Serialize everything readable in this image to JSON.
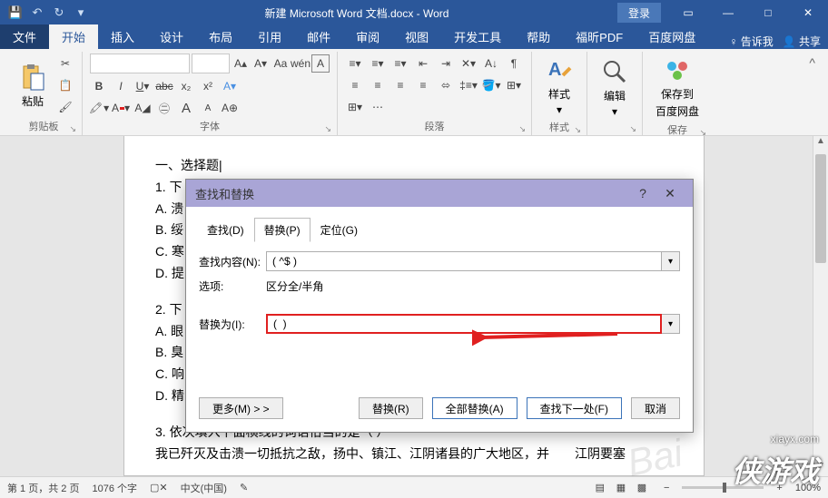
{
  "titlebar": {
    "doc_title": "新建 Microsoft Word 文档.docx - Word",
    "login": "登录"
  },
  "tabs": {
    "file": "文件",
    "home": "开始",
    "insert": "插入",
    "design": "设计",
    "layout": "布局",
    "ref": "引用",
    "mail": "邮件",
    "review": "审阅",
    "view": "视图",
    "dev": "开发工具",
    "help": "帮助",
    "foxit": "福昕PDF",
    "baidu": "百度网盘",
    "tell": "告诉我",
    "share": "共享"
  },
  "clipboard": {
    "paste": "粘贴",
    "group": "剪贴板"
  },
  "font": {
    "group": "字体",
    "wen": "wén",
    "a_box": "A"
  },
  "para": {
    "group": "段落"
  },
  "styles": {
    "label": "样式",
    "group": "样式"
  },
  "editing": {
    "label": "编辑"
  },
  "baidu_save": {
    "line1": "保存到",
    "line2": "百度网盘",
    "group": "保存"
  },
  "document": {
    "l1": "一、选择题",
    "l2": "1. 下",
    "l3": "A. 溃",
    "l4": "B. 绥",
    "l5": "C. 寒",
    "l6": "D. 提",
    "l7": "2. 下",
    "l8": "A. 眼",
    "l9": "B. 臭",
    "l10": "C. 响",
    "l11": "D. 精",
    "l12": "3. 依次填入下面横线的词语恰当的是（ ）",
    "l13": "我已歼灭及击溃一切抵抗之敌，扬中、镇江、江阴诸县的广大地区，并　　江阴要塞"
  },
  "dialog": {
    "title": "查找和替换",
    "tab_find": "查找(D)",
    "tab_replace": "替换(P)",
    "tab_goto": "定位(G)",
    "find_label": "查找内容(N):",
    "find_value": "( ^$ )",
    "options_label": "选项:",
    "options_value": "区分全/半角",
    "replace_label": "替换为(I):",
    "replace_value": "(  )",
    "btn_more": "更多(M) > >",
    "btn_replace": "替换(R)",
    "btn_replace_all": "全部替换(A)",
    "btn_find_next": "查找下一处(F)",
    "btn_cancel": "取消"
  },
  "status": {
    "page": "第 1 页，共 2 页",
    "words": "1076 个字",
    "lang": "中文(中国)",
    "zoom": "100%"
  },
  "watermark": {
    "site": "xiayx.com",
    "brand": "侠游戏"
  }
}
